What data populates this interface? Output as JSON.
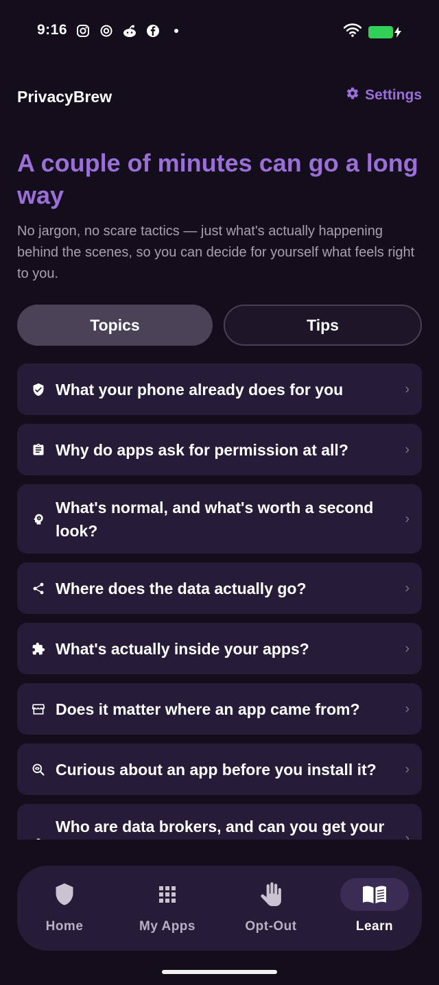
{
  "status_bar": {
    "time": "9:16",
    "left_icons": [
      "instagram-icon",
      "threads-icon",
      "reddit-icon",
      "facebook-icon"
    ],
    "right_icons": [
      "wifi-icon",
      "battery-charging-icon"
    ],
    "battery_color": "#31d158"
  },
  "header": {
    "title": "PrivacyBrew",
    "settings_label": "Settings"
  },
  "hero": {
    "title": "A couple of minutes can go a long way",
    "subtitle": "No jargon, no scare tactics — just what's actually happening behind the scenes, so you can decide for yourself what feels right to you."
  },
  "tabs": {
    "topics": "Topics",
    "tips": "Tips",
    "selected": "Topics"
  },
  "topics": [
    {
      "label": "What your phone already does for you",
      "icon": "shield-check-icon"
    },
    {
      "label": "Why do apps ask for permission at all?",
      "icon": "clipboard-icon"
    },
    {
      "label": "What's normal, and what's worth a second look?",
      "icon": "head-gear-icon"
    },
    {
      "label": "Where does the data actually go?",
      "icon": "share-icon"
    },
    {
      "label": "What's actually inside your apps?",
      "icon": "puzzle-icon"
    },
    {
      "label": "Does it matter where an app came from?",
      "icon": "storefront-icon"
    },
    {
      "label": "Curious about an app before you install it?",
      "icon": "search-eye-icon"
    },
    {
      "label": "Who are data brokers, and can you get your",
      "icon": "person-icon"
    }
  ],
  "nav": {
    "home": "Home",
    "my_apps": "My Apps",
    "opt_out": "Opt-Out",
    "learn": "Learn",
    "active": "Learn"
  },
  "colors": {
    "background": "#130d1c",
    "card": "#271c38",
    "accent": "#9b6fd8",
    "muted_text": "#a7a0b2"
  }
}
